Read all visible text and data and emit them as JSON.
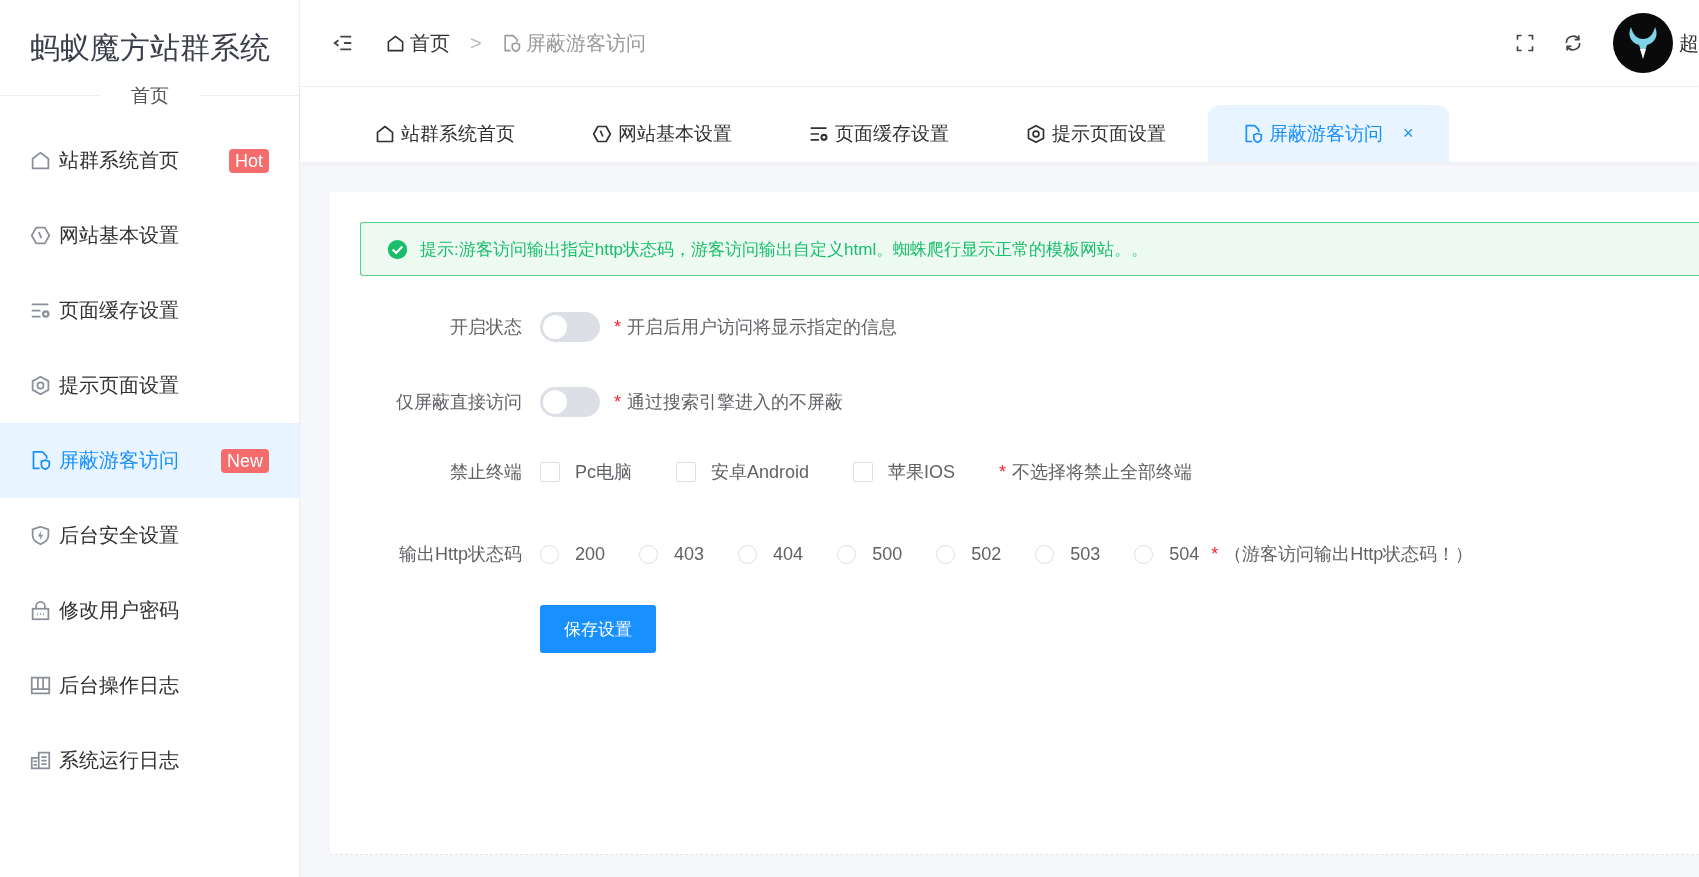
{
  "sidebar": {
    "title": "蚂蚁魔方站群系统",
    "section": "首页",
    "items": [
      {
        "label": "站群系统首页",
        "badge": "Hot",
        "selected": false
      },
      {
        "label": "网站基本设置",
        "selected": false
      },
      {
        "label": "页面缓存设置",
        "selected": false
      },
      {
        "label": "提示页面设置",
        "selected": false
      },
      {
        "label": "屏蔽游客访问",
        "badge": "New",
        "selected": true
      },
      {
        "label": "后台安全设置",
        "selected": false
      },
      {
        "label": "修改用户密码",
        "selected": false
      },
      {
        "label": "后台操作日志",
        "selected": false
      },
      {
        "label": "系统运行日志",
        "selected": false
      }
    ]
  },
  "header": {
    "breadcrumb": [
      {
        "label": "首页"
      },
      {
        "label": "屏蔽游客访问"
      }
    ],
    "separator": ">",
    "user_name": "超"
  },
  "tabs": [
    {
      "label": "站群系统首页",
      "selected": false
    },
    {
      "label": "网站基本设置",
      "selected": false
    },
    {
      "label": "页面缓存设置",
      "selected": false
    },
    {
      "label": "提示页面设置",
      "selected": false
    },
    {
      "label": "屏蔽游客访问",
      "selected": true,
      "close": "×"
    }
  ],
  "alert": {
    "text": "提示:游客访问输出指定http状态码，游客访问输出自定义html。蜘蛛爬行显示正常的模板网站。。"
  },
  "form": {
    "rows": [
      {
        "kind": "switch",
        "label": "开启状态",
        "on": false,
        "mark": "*",
        "note": "开启后用户访问将显示指定的信息"
      },
      {
        "kind": "switch",
        "label": "仅屏蔽直接访问",
        "on": false,
        "mark": "*",
        "note": "通过搜索引擎进入的不屏蔽"
      },
      {
        "kind": "checkboxes",
        "label": "禁止终端",
        "options": [
          {
            "label": "Pc电脑",
            "checked": false
          },
          {
            "label": "安卓Android",
            "checked": false
          },
          {
            "label": "苹果IOS",
            "checked": false
          }
        ],
        "mark": "*",
        "note": "不选择将禁止全部终端"
      },
      {
        "kind": "radios",
        "label": "输出Http状态码",
        "options": [
          {
            "label": "200",
            "selected": false
          },
          {
            "label": "403",
            "selected": false
          },
          {
            "label": "404",
            "selected": false
          },
          {
            "label": "500",
            "selected": false
          },
          {
            "label": "502",
            "selected": false
          },
          {
            "label": "503",
            "selected": false
          },
          {
            "label": "504",
            "selected": false
          }
        ],
        "mark": "*",
        "note": "（游客访问输出Http状态码！）"
      }
    ],
    "save_button": "保存设置"
  }
}
